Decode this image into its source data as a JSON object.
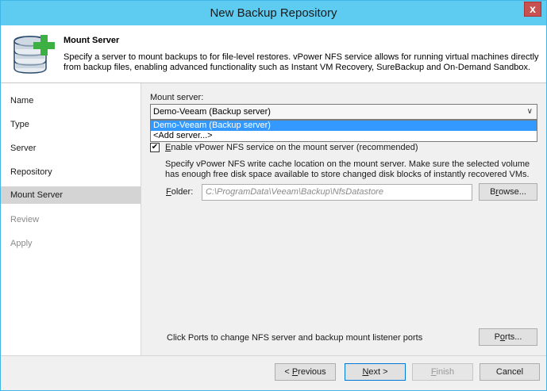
{
  "window": {
    "title": "New Backup Repository",
    "close_glyph": "x"
  },
  "header": {
    "title": "Mount Server",
    "description": "Specify a server to mount backups to for file-level restores. vPower NFS service allows for running virtual machines directly from backup files, enabling advanced functionality such as Instant VM Recovery, SureBackup and On-Demand Sandbox.",
    "icon": "database-add-icon"
  },
  "sidebar": {
    "items": [
      {
        "label": "Name",
        "state": "done"
      },
      {
        "label": "Type",
        "state": "done"
      },
      {
        "label": "Server",
        "state": "done"
      },
      {
        "label": "Repository",
        "state": "done"
      },
      {
        "label": "Mount Server",
        "state": "active"
      },
      {
        "label": "Review",
        "state": "disabled"
      },
      {
        "label": "Apply",
        "state": "disabled"
      }
    ]
  },
  "mount": {
    "label": "Mount server:",
    "selected": "Demo-Veeam (Backup server)",
    "options": [
      "Demo-Veeam (Backup server)",
      "<Add server...>"
    ],
    "checkbox_label_first": "E",
    "checkbox_label_rest": "nable vPower NFS service on the mount server (recommended)",
    "checkbox_checked": true,
    "cache_help": "Specify vPower NFS write cache location on the mount server. Make sure the selected volume has enough free disk space available to store changed disk blocks of instantly recovered VMs.",
    "folder_label_first": "F",
    "folder_label_rest": "older:",
    "folder_value": "C:\\ProgramData\\Veeam\\Backup\\NfsDatastore",
    "browse_label_pre": "B",
    "browse_label_u": "r",
    "browse_label_post": "owse...",
    "ports_help": "Click Ports to change NFS server and backup mount listener ports",
    "ports_label_pre": "P",
    "ports_label_u": "o",
    "ports_label_post": "rts..."
  },
  "footer": {
    "previous_pre": "< ",
    "previous_u": "P",
    "previous_post": "revious",
    "next_u": "N",
    "next_post": "ext >",
    "finish_u": "F",
    "finish_post": "inish",
    "cancel": "Cancel"
  }
}
